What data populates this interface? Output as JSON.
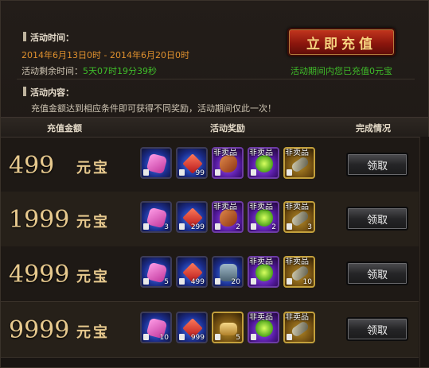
{
  "activity": {
    "time_label": "活动时间：",
    "time_range": "2014年6月13日0时 - 2014年6月20日0时",
    "remaining_label": "活动剩余时间：",
    "remaining_value": "5天07时19分39秒",
    "recharge_button": "立即充值",
    "recharged_status": "活动期间内您已充值0元宝",
    "content_label": "活动内容：",
    "content_text": "充值金额达到相应条件即可获得不同奖励，活动期间仅此一次！"
  },
  "table": {
    "headers": [
      "充值金额",
      "活动奖励",
      "完成情况"
    ],
    "unit": "元宝",
    "claim_label": "领取",
    "rows": [
      {
        "amount": "499",
        "items": [
          {
            "icon": "gift-box-icon",
            "style": "blue",
            "glyph": "box",
            "tag": "",
            "qty": ""
          },
          {
            "icon": "red-gem-icon",
            "style": "blue",
            "glyph": "gem",
            "tag": "",
            "qty": "99"
          },
          {
            "icon": "meat-icon",
            "style": "purple",
            "glyph": "meat",
            "tag": "非卖品",
            "qty": ""
          },
          {
            "icon": "green-orb-icon",
            "style": "purple",
            "glyph": "orb",
            "tag": "非卖品",
            "qty": ""
          },
          {
            "icon": "cannon-icon",
            "style": "gold",
            "glyph": "cannon",
            "tag": "非卖品",
            "qty": ""
          }
        ]
      },
      {
        "amount": "1999",
        "items": [
          {
            "icon": "gift-box-icon",
            "style": "blue",
            "glyph": "box",
            "tag": "",
            "qty": "3"
          },
          {
            "icon": "red-gem-icon",
            "style": "blue",
            "glyph": "gem",
            "tag": "",
            "qty": "299"
          },
          {
            "icon": "meat-icon",
            "style": "purple",
            "glyph": "meat",
            "tag": "非卖品",
            "qty": "2"
          },
          {
            "icon": "green-orb-icon",
            "style": "purple",
            "glyph": "orb",
            "tag": "非卖品",
            "qty": "2"
          },
          {
            "icon": "cannon-icon",
            "style": "gold",
            "glyph": "cannon",
            "tag": "非卖品",
            "qty": "3"
          }
        ]
      },
      {
        "amount": "4999",
        "items": [
          {
            "icon": "gift-box-icon",
            "style": "blue",
            "glyph": "box",
            "tag": "",
            "qty": "5"
          },
          {
            "icon": "red-gem-icon",
            "style": "blue",
            "glyph": "gem",
            "tag": "",
            "qty": "499"
          },
          {
            "icon": "chest-icon",
            "style": "blue",
            "glyph": "chest",
            "tag": "",
            "qty": "20"
          },
          {
            "icon": "green-orb-icon",
            "style": "purple",
            "glyph": "orb",
            "tag": "非卖品",
            "qty": ""
          },
          {
            "icon": "cannon-icon",
            "style": "gold",
            "glyph": "cannon",
            "tag": "非卖品",
            "qty": "10"
          }
        ]
      },
      {
        "amount": "9999",
        "items": [
          {
            "icon": "gift-box-icon",
            "style": "blue",
            "glyph": "box",
            "tag": "",
            "qty": "10"
          },
          {
            "icon": "red-gem-icon",
            "style": "blue",
            "glyph": "gem",
            "tag": "",
            "qty": "999"
          },
          {
            "icon": "scroll-icon",
            "style": "gold",
            "glyph": "scroll",
            "tag": "",
            "qty": "5"
          },
          {
            "icon": "green-orb-icon",
            "style": "purple",
            "glyph": "orb",
            "tag": "非卖品",
            "qty": ""
          },
          {
            "icon": "cannon-icon",
            "style": "gold",
            "glyph": "cannon",
            "tag": "非卖品",
            "qty": ""
          }
        ]
      }
    ]
  }
}
